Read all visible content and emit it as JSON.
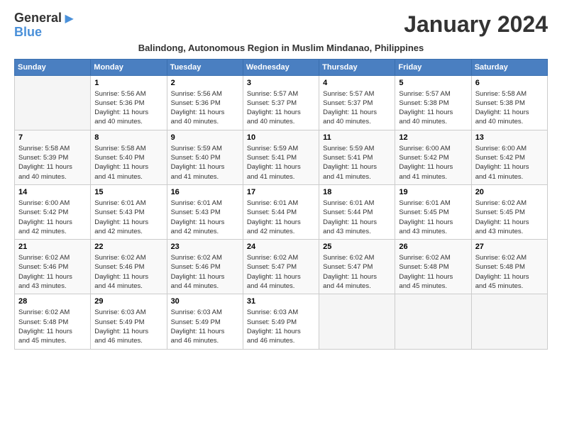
{
  "header": {
    "logo_general": "General",
    "logo_blue": "Blue",
    "month_title": "January 2024",
    "subtitle": "Balindong, Autonomous Region in Muslim Mindanao, Philippines"
  },
  "weekdays": [
    "Sunday",
    "Monday",
    "Tuesday",
    "Wednesday",
    "Thursday",
    "Friday",
    "Saturday"
  ],
  "weeks": [
    [
      {
        "day": "",
        "info": ""
      },
      {
        "day": "1",
        "info": "Sunrise: 5:56 AM\nSunset: 5:36 PM\nDaylight: 11 hours\nand 40 minutes."
      },
      {
        "day": "2",
        "info": "Sunrise: 5:56 AM\nSunset: 5:36 PM\nDaylight: 11 hours\nand 40 minutes."
      },
      {
        "day": "3",
        "info": "Sunrise: 5:57 AM\nSunset: 5:37 PM\nDaylight: 11 hours\nand 40 minutes."
      },
      {
        "day": "4",
        "info": "Sunrise: 5:57 AM\nSunset: 5:37 PM\nDaylight: 11 hours\nand 40 minutes."
      },
      {
        "day": "5",
        "info": "Sunrise: 5:57 AM\nSunset: 5:38 PM\nDaylight: 11 hours\nand 40 minutes."
      },
      {
        "day": "6",
        "info": "Sunrise: 5:58 AM\nSunset: 5:38 PM\nDaylight: 11 hours\nand 40 minutes."
      }
    ],
    [
      {
        "day": "7",
        "info": "Sunrise: 5:58 AM\nSunset: 5:39 PM\nDaylight: 11 hours\nand 40 minutes."
      },
      {
        "day": "8",
        "info": "Sunrise: 5:58 AM\nSunset: 5:40 PM\nDaylight: 11 hours\nand 41 minutes."
      },
      {
        "day": "9",
        "info": "Sunrise: 5:59 AM\nSunset: 5:40 PM\nDaylight: 11 hours\nand 41 minutes."
      },
      {
        "day": "10",
        "info": "Sunrise: 5:59 AM\nSunset: 5:41 PM\nDaylight: 11 hours\nand 41 minutes."
      },
      {
        "day": "11",
        "info": "Sunrise: 5:59 AM\nSunset: 5:41 PM\nDaylight: 11 hours\nand 41 minutes."
      },
      {
        "day": "12",
        "info": "Sunrise: 6:00 AM\nSunset: 5:42 PM\nDaylight: 11 hours\nand 41 minutes."
      },
      {
        "day": "13",
        "info": "Sunrise: 6:00 AM\nSunset: 5:42 PM\nDaylight: 11 hours\nand 41 minutes."
      }
    ],
    [
      {
        "day": "14",
        "info": "Sunrise: 6:00 AM\nSunset: 5:42 PM\nDaylight: 11 hours\nand 42 minutes."
      },
      {
        "day": "15",
        "info": "Sunrise: 6:01 AM\nSunset: 5:43 PM\nDaylight: 11 hours\nand 42 minutes."
      },
      {
        "day": "16",
        "info": "Sunrise: 6:01 AM\nSunset: 5:43 PM\nDaylight: 11 hours\nand 42 minutes."
      },
      {
        "day": "17",
        "info": "Sunrise: 6:01 AM\nSunset: 5:44 PM\nDaylight: 11 hours\nand 42 minutes."
      },
      {
        "day": "18",
        "info": "Sunrise: 6:01 AM\nSunset: 5:44 PM\nDaylight: 11 hours\nand 43 minutes."
      },
      {
        "day": "19",
        "info": "Sunrise: 6:01 AM\nSunset: 5:45 PM\nDaylight: 11 hours\nand 43 minutes."
      },
      {
        "day": "20",
        "info": "Sunrise: 6:02 AM\nSunset: 5:45 PM\nDaylight: 11 hours\nand 43 minutes."
      }
    ],
    [
      {
        "day": "21",
        "info": "Sunrise: 6:02 AM\nSunset: 5:46 PM\nDaylight: 11 hours\nand 43 minutes."
      },
      {
        "day": "22",
        "info": "Sunrise: 6:02 AM\nSunset: 5:46 PM\nDaylight: 11 hours\nand 44 minutes."
      },
      {
        "day": "23",
        "info": "Sunrise: 6:02 AM\nSunset: 5:46 PM\nDaylight: 11 hours\nand 44 minutes."
      },
      {
        "day": "24",
        "info": "Sunrise: 6:02 AM\nSunset: 5:47 PM\nDaylight: 11 hours\nand 44 minutes."
      },
      {
        "day": "25",
        "info": "Sunrise: 6:02 AM\nSunset: 5:47 PM\nDaylight: 11 hours\nand 44 minutes."
      },
      {
        "day": "26",
        "info": "Sunrise: 6:02 AM\nSunset: 5:48 PM\nDaylight: 11 hours\nand 45 minutes."
      },
      {
        "day": "27",
        "info": "Sunrise: 6:02 AM\nSunset: 5:48 PM\nDaylight: 11 hours\nand 45 minutes."
      }
    ],
    [
      {
        "day": "28",
        "info": "Sunrise: 6:02 AM\nSunset: 5:48 PM\nDaylight: 11 hours\nand 45 minutes."
      },
      {
        "day": "29",
        "info": "Sunrise: 6:03 AM\nSunset: 5:49 PM\nDaylight: 11 hours\nand 46 minutes."
      },
      {
        "day": "30",
        "info": "Sunrise: 6:03 AM\nSunset: 5:49 PM\nDaylight: 11 hours\nand 46 minutes."
      },
      {
        "day": "31",
        "info": "Sunrise: 6:03 AM\nSunset: 5:49 PM\nDaylight: 11 hours\nand 46 minutes."
      },
      {
        "day": "",
        "info": ""
      },
      {
        "day": "",
        "info": ""
      },
      {
        "day": "",
        "info": ""
      }
    ]
  ]
}
